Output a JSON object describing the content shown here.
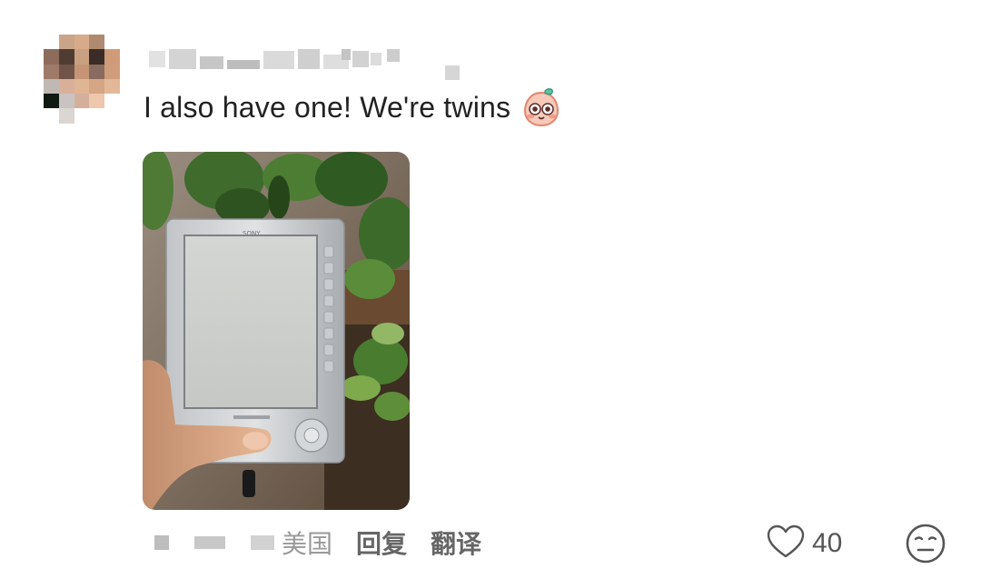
{
  "comment": {
    "text": "I also have one! We're twins",
    "emoji_icon": "blushing-peach-emoji-icon",
    "photo_icon": "ereader-photo"
  },
  "footer": {
    "location": "美国",
    "reply_label": "回复",
    "translate_label": "翻译",
    "like_count": "40",
    "like_icon": "heart-outline-icon",
    "reaction_icon": "meh-face-icon"
  },
  "colors": {
    "text": "#222222",
    "muted": "#999999",
    "action": "#666666"
  }
}
